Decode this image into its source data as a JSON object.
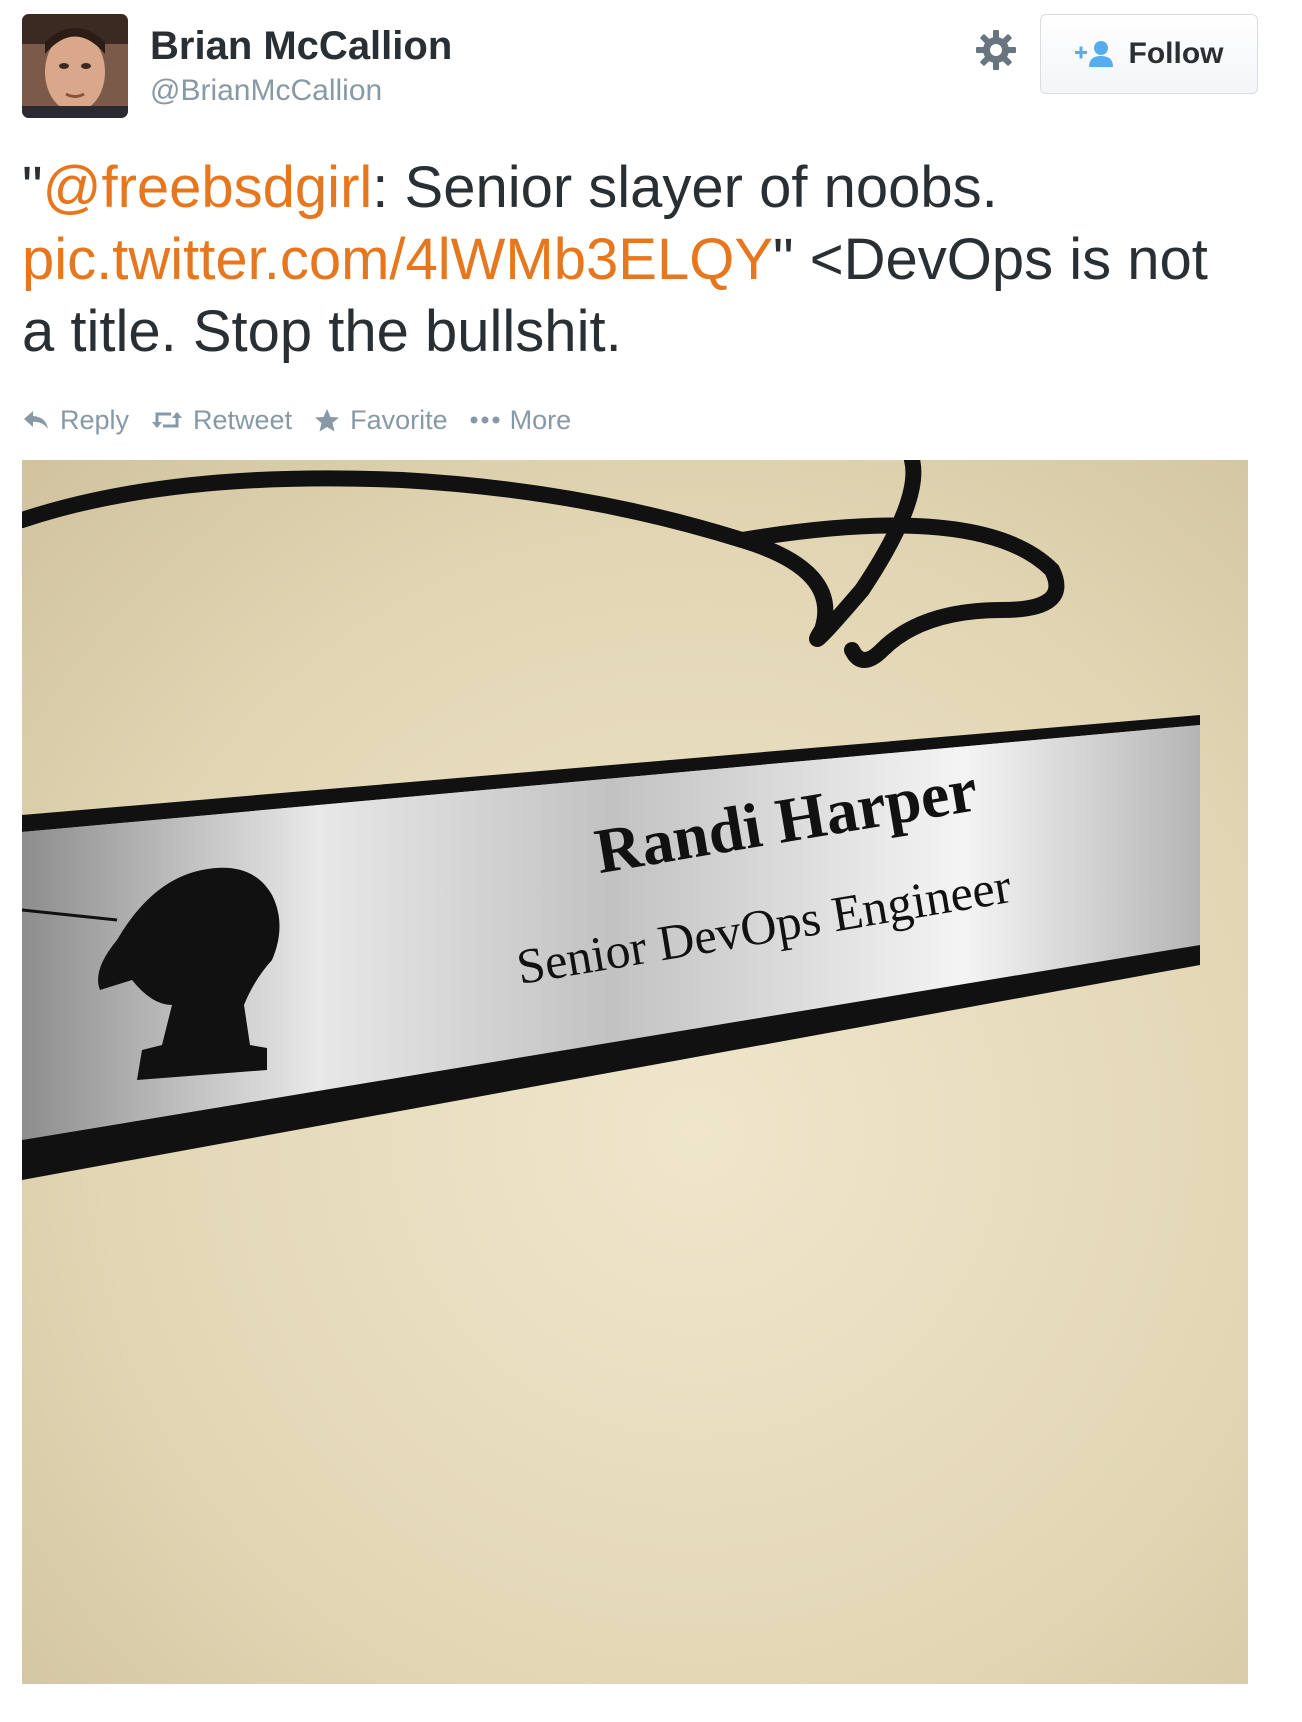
{
  "user": {
    "name": "Brian McCallion",
    "handle": "@BrianMcCallion"
  },
  "follow_button": {
    "label": "Follow"
  },
  "tweet": {
    "quote_open": "\"",
    "mention": "@freebsdgirl",
    "text_1": ": Senior slayer of noobs.",
    "link": "pic.twitter.com/4lWMb3ELQY",
    "text_2": "\" <DevOps is not a title. Stop the bullshit."
  },
  "actions": {
    "reply": "Reply",
    "retweet": "Retweet",
    "favorite": "Favorite",
    "more": "More"
  },
  "photo": {
    "plate_name": "Randi Harper",
    "plate_title": "Senior DevOps Engineer"
  },
  "colors": {
    "link": "#e6771e",
    "text": "#292f33",
    "muted": "#8899a6",
    "follow_icon": "#55acee"
  }
}
